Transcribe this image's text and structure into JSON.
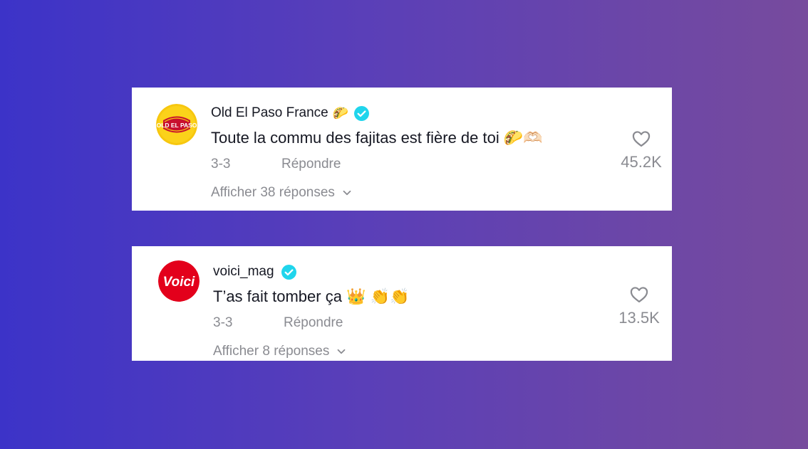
{
  "colors": {
    "verified": "#20d5ec",
    "muted_text": "#8a8b91",
    "primary_text": "#161823",
    "background_start": "#3c33c8",
    "background_end": "#774b9d"
  },
  "comments": [
    {
      "avatar": "old-el-paso-logo",
      "avatar_logo_text": "OLD EL PASO",
      "username": "Old El Paso France",
      "name_emoji": "🌮",
      "verified": true,
      "text": "Toute la commu des fajitas est fière de toi 🌮🫶🏻",
      "date": "3-3",
      "reply_label": "Répondre",
      "view_replies_label": "Afficher 38 réponses",
      "likes": "45.2K"
    },
    {
      "avatar": "voici-logo",
      "avatar_logo_text": "Voici",
      "username": "voici_mag",
      "name_emoji": "",
      "verified": true,
      "text": "T’as fait tomber ça 👑 👏👏",
      "date": "3-3",
      "reply_label": "Répondre",
      "view_replies_label": "Afficher 8 réponses",
      "likes": "13.5K"
    }
  ]
}
